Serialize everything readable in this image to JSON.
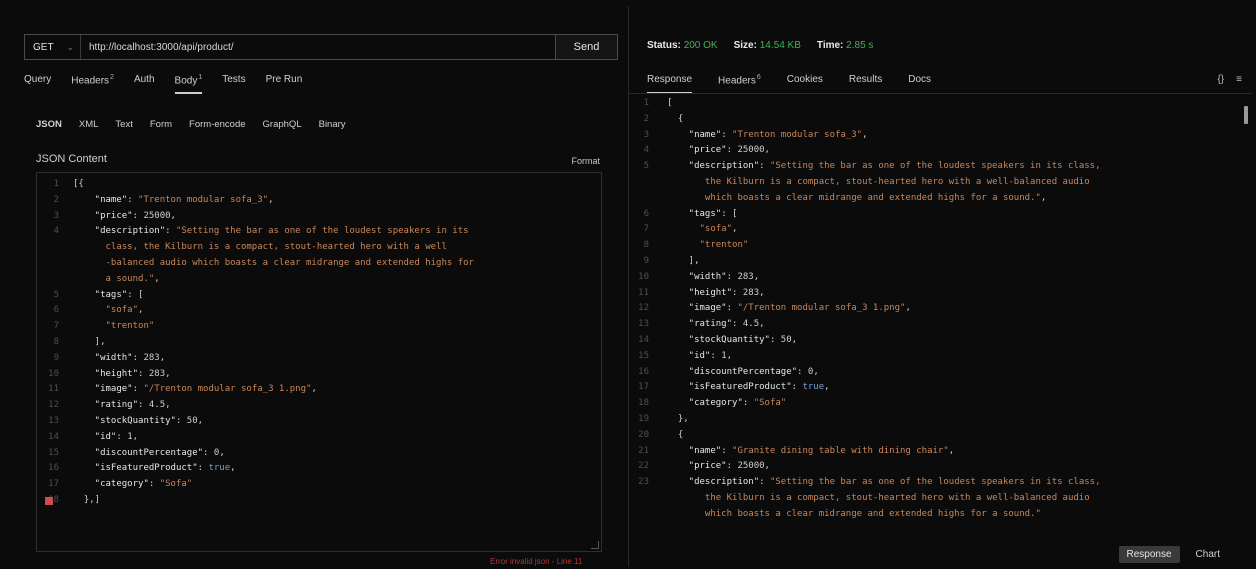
{
  "request": {
    "method": "GET",
    "url": "http://localhost:3000/api/product/",
    "send_label": "Send"
  },
  "left_tabs": [
    {
      "label": "Query",
      "count": ""
    },
    {
      "label": "Headers",
      "count": "2"
    },
    {
      "label": "Auth",
      "count": ""
    },
    {
      "label": "Body",
      "count": "1"
    },
    {
      "label": "Tests",
      "count": ""
    },
    {
      "label": "Pre Run",
      "count": ""
    }
  ],
  "body_types": [
    "JSON",
    "XML",
    "Text",
    "Form",
    "Form-encode",
    "GraphQL",
    "Binary"
  ],
  "json_content_label": "JSON Content",
  "format_label": "Format",
  "error_message": "Error invalid json - Line 11",
  "status": {
    "status_label": "Status:",
    "status_value": "200 OK",
    "size_label": "Size:",
    "size_value": "14.54 KB",
    "time_label": "Time:",
    "time_value": "2.85 s"
  },
  "right_tabs": [
    {
      "label": "Response",
      "count": ""
    },
    {
      "label": "Headers",
      "count": "6"
    },
    {
      "label": "Cookies",
      "count": ""
    },
    {
      "label": "Results",
      "count": ""
    },
    {
      "label": "Docs",
      "count": ""
    }
  ],
  "right_icons": [
    "{}",
    "≡"
  ],
  "bottom_buttons": {
    "response": "Response",
    "chart": "Chart"
  },
  "request_body_lines": [
    {
      "ln": "1",
      "t": [
        [
          "p",
          "[{"
        ]
      ]
    },
    {
      "ln": "2",
      "t": [
        [
          "k",
          "    \"name\""
        ],
        [
          "p",
          ": "
        ],
        [
          "s",
          "\"Trenton modular sofa_3\""
        ],
        [
          "p",
          ","
        ]
      ]
    },
    {
      "ln": "3",
      "t": [
        [
          "k",
          "    \"price\""
        ],
        [
          "p",
          ": "
        ],
        [
          "n",
          "25000"
        ],
        [
          "p",
          ","
        ]
      ]
    },
    {
      "ln": "4",
      "t": [
        [
          "k",
          "    \"description\""
        ],
        [
          "p",
          ": "
        ],
        [
          "s",
          "\"Setting the bar as one of the loudest speakers in its"
        ]
      ]
    },
    {
      "ln": "",
      "t": [
        [
          "s",
          "      class, the Kilburn is a compact, stout-hearted hero with a well"
        ]
      ]
    },
    {
      "ln": "",
      "t": [
        [
          "s",
          "      -balanced audio which boasts a clear midrange and extended highs for"
        ]
      ]
    },
    {
      "ln": "",
      "t": [
        [
          "s",
          "      a sound.\""
        ],
        [
          "p",
          ","
        ]
      ]
    },
    {
      "ln": "5",
      "t": [
        [
          "k",
          "    \"tags\""
        ],
        [
          "p",
          ": ["
        ]
      ]
    },
    {
      "ln": "6",
      "t": [
        [
          "s",
          "      \"sofa\""
        ],
        [
          "p",
          ","
        ]
      ]
    },
    {
      "ln": "7",
      "t": [
        [
          "s",
          "      \"trenton\""
        ]
      ]
    },
    {
      "ln": "8",
      "t": [
        [
          "p",
          "    ],"
        ]
      ]
    },
    {
      "ln": "9",
      "t": [
        [
          "k",
          "    \"width\""
        ],
        [
          "p",
          ": "
        ],
        [
          "n",
          "283"
        ],
        [
          "p",
          ","
        ]
      ]
    },
    {
      "ln": "10",
      "t": [
        [
          "k",
          "    \"height\""
        ],
        [
          "p",
          ": "
        ],
        [
          "n",
          "283"
        ],
        [
          "p",
          ","
        ]
      ]
    },
    {
      "ln": "11",
      "t": [
        [
          "k",
          "    \"image\""
        ],
        [
          "p",
          ": "
        ],
        [
          "s",
          "\"/Trenton modular sofa_3 1.png\""
        ],
        [
          "p",
          ","
        ]
      ]
    },
    {
      "ln": "12",
      "t": [
        [
          "k",
          "    \"rating\""
        ],
        [
          "p",
          ": "
        ],
        [
          "n",
          "4.5"
        ],
        [
          "p",
          ","
        ]
      ]
    },
    {
      "ln": "13",
      "t": [
        [
          "k",
          "    \"stockQuantity\""
        ],
        [
          "p",
          ": "
        ],
        [
          "n",
          "50"
        ],
        [
          "p",
          ","
        ]
      ]
    },
    {
      "ln": "14",
      "t": [
        [
          "k",
          "    \"id\""
        ],
        [
          "p",
          ": "
        ],
        [
          "n",
          "1"
        ],
        [
          "p",
          ","
        ]
      ]
    },
    {
      "ln": "15",
      "t": [
        [
          "k",
          "    \"discountPercentage\""
        ],
        [
          "p",
          ": "
        ],
        [
          "n",
          "0"
        ],
        [
          "p",
          ","
        ]
      ]
    },
    {
      "ln": "16",
      "t": [
        [
          "k",
          "    \"isFeaturedProduct\""
        ],
        [
          "p",
          ": "
        ],
        [
          "b",
          "true"
        ],
        [
          "p",
          ","
        ]
      ]
    },
    {
      "ln": "17",
      "t": [
        [
          "k",
          "    \"category\""
        ],
        [
          "p",
          ": "
        ],
        [
          "s",
          "\"Sofa\""
        ]
      ]
    },
    {
      "ln": "18",
      "t": [
        [
          "p",
          "  },]"
        ]
      ],
      "error": true
    }
  ],
  "response_lines": [
    {
      "ln": "1",
      "t": [
        [
          "p",
          "["
        ]
      ]
    },
    {
      "ln": "2",
      "t": [
        [
          "p",
          "  {"
        ]
      ]
    },
    {
      "ln": "3",
      "t": [
        [
          "k",
          "    \"name\""
        ],
        [
          "p",
          ": "
        ],
        [
          "s",
          "\"Trenton modular sofa_3\""
        ],
        [
          "p",
          ","
        ]
      ]
    },
    {
      "ln": "4",
      "t": [
        [
          "k",
          "    \"price\""
        ],
        [
          "p",
          ": "
        ],
        [
          "n",
          "25000"
        ],
        [
          "p",
          ","
        ]
      ]
    },
    {
      "ln": "5",
      "t": [
        [
          "k",
          "    \"description\""
        ],
        [
          "p",
          ": "
        ],
        [
          "s",
          "\"Setting the bar as one of the loudest speakers in its class,"
        ]
      ]
    },
    {
      "ln": "",
      "t": [
        [
          "s",
          "       the Kilburn is a compact, stout-hearted hero with a well-balanced audio"
        ]
      ]
    },
    {
      "ln": "",
      "t": [
        [
          "s",
          "       which boasts a clear midrange and extended highs for a sound.\""
        ],
        [
          "p",
          ","
        ]
      ]
    },
    {
      "ln": "6",
      "t": [
        [
          "k",
          "    \"tags\""
        ],
        [
          "p",
          ": ["
        ]
      ]
    },
    {
      "ln": "7",
      "t": [
        [
          "s",
          "      \"sofa\""
        ],
        [
          "p",
          ","
        ]
      ]
    },
    {
      "ln": "8",
      "t": [
        [
          "s",
          "      \"trenton\""
        ]
      ]
    },
    {
      "ln": "9",
      "t": [
        [
          "p",
          "    ],"
        ]
      ]
    },
    {
      "ln": "10",
      "t": [
        [
          "k",
          "    \"width\""
        ],
        [
          "p",
          ": "
        ],
        [
          "n",
          "283"
        ],
        [
          "p",
          ","
        ]
      ]
    },
    {
      "ln": "11",
      "t": [
        [
          "k",
          "    \"height\""
        ],
        [
          "p",
          ": "
        ],
        [
          "n",
          "283"
        ],
        [
          "p",
          ","
        ]
      ]
    },
    {
      "ln": "12",
      "t": [
        [
          "k",
          "    \"image\""
        ],
        [
          "p",
          ": "
        ],
        [
          "s",
          "\"/Trenton modular sofa_3 1.png\""
        ],
        [
          "p",
          ","
        ]
      ]
    },
    {
      "ln": "13",
      "t": [
        [
          "k",
          "    \"rating\""
        ],
        [
          "p",
          ": "
        ],
        [
          "n",
          "4.5"
        ],
        [
          "p",
          ","
        ]
      ]
    },
    {
      "ln": "14",
      "t": [
        [
          "k",
          "    \"stockQuantity\""
        ],
        [
          "p",
          ": "
        ],
        [
          "n",
          "50"
        ],
        [
          "p",
          ","
        ]
      ]
    },
    {
      "ln": "15",
      "t": [
        [
          "k",
          "    \"id\""
        ],
        [
          "p",
          ": "
        ],
        [
          "n",
          "1"
        ],
        [
          "p",
          ","
        ]
      ]
    },
    {
      "ln": "16",
      "t": [
        [
          "k",
          "    \"discountPercentage\""
        ],
        [
          "p",
          ": "
        ],
        [
          "n",
          "0"
        ],
        [
          "p",
          ","
        ]
      ]
    },
    {
      "ln": "17",
      "t": [
        [
          "k",
          "    \"isFeaturedProduct\""
        ],
        [
          "p",
          ": "
        ],
        [
          "b",
          "true"
        ],
        [
          "p",
          ","
        ]
      ]
    },
    {
      "ln": "18",
      "t": [
        [
          "k",
          "    \"category\""
        ],
        [
          "p",
          ": "
        ],
        [
          "s",
          "\"Sofa\""
        ]
      ]
    },
    {
      "ln": "19",
      "t": [
        [
          "p",
          "  },"
        ]
      ]
    },
    {
      "ln": "20",
      "t": [
        [
          "p",
          "  {"
        ]
      ]
    },
    {
      "ln": "21",
      "t": [
        [
          "k",
          "    \"name\""
        ],
        [
          "p",
          ": "
        ],
        [
          "s",
          "\"Granite dining table with dining chair\""
        ],
        [
          "p",
          ","
        ]
      ]
    },
    {
      "ln": "22",
      "t": [
        [
          "k",
          "    \"price\""
        ],
        [
          "p",
          ": "
        ],
        [
          "n",
          "25000"
        ],
        [
          "p",
          ","
        ]
      ]
    },
    {
      "ln": "23",
      "t": [
        [
          "k",
          "    \"description\""
        ],
        [
          "p",
          ": "
        ],
        [
          "s",
          "\"Setting the bar as one of the loudest speakers in its class,"
        ]
      ]
    },
    {
      "ln": "",
      "t": [
        [
          "s",
          "       the Kilburn is a compact, stout-hearted hero with a well-balanced audio"
        ]
      ]
    },
    {
      "ln": "",
      "t": [
        [
          "s",
          "       which boasts a clear midrange and extended highs for a sound.\""
        ]
      ]
    }
  ]
}
